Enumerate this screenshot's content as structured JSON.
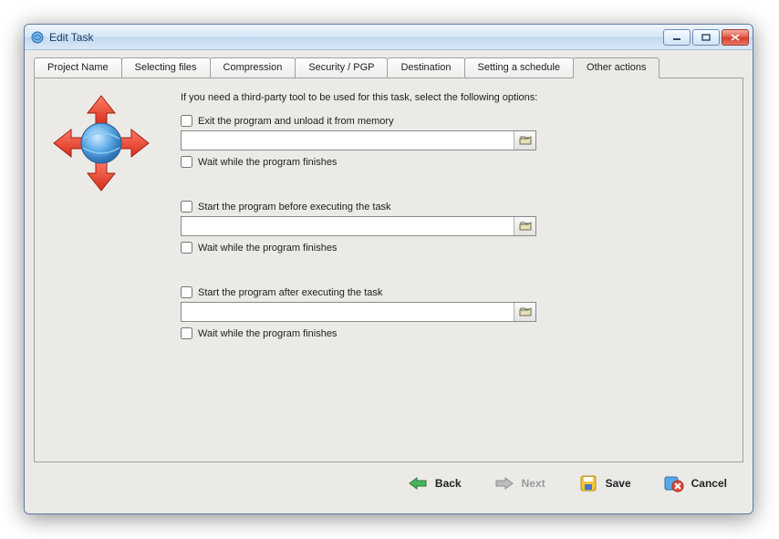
{
  "window": {
    "title": "Edit Task"
  },
  "tabs": [
    {
      "label": "Project Name"
    },
    {
      "label": "Selecting files"
    },
    {
      "label": "Compression"
    },
    {
      "label": "Security / PGP"
    },
    {
      "label": "Destination"
    },
    {
      "label": "Setting a schedule"
    },
    {
      "label": "Other actions"
    }
  ],
  "active_tab_index": 6,
  "page": {
    "intro": "If you need a third-party tool to be used for this task, select the following options:",
    "groups": [
      {
        "top_check": "Exit the program and unload it from memory",
        "path": "",
        "wait_check": "Wait while the program finishes"
      },
      {
        "top_check": "Start the program before executing the task",
        "path": "",
        "wait_check": "Wait while the program finishes"
      },
      {
        "top_check": "Start the program after executing the task",
        "path": "",
        "wait_check": "Wait while the program finishes"
      }
    ]
  },
  "footer": {
    "back": "Back",
    "next": "Next",
    "save": "Save",
    "cancel": "Cancel"
  }
}
